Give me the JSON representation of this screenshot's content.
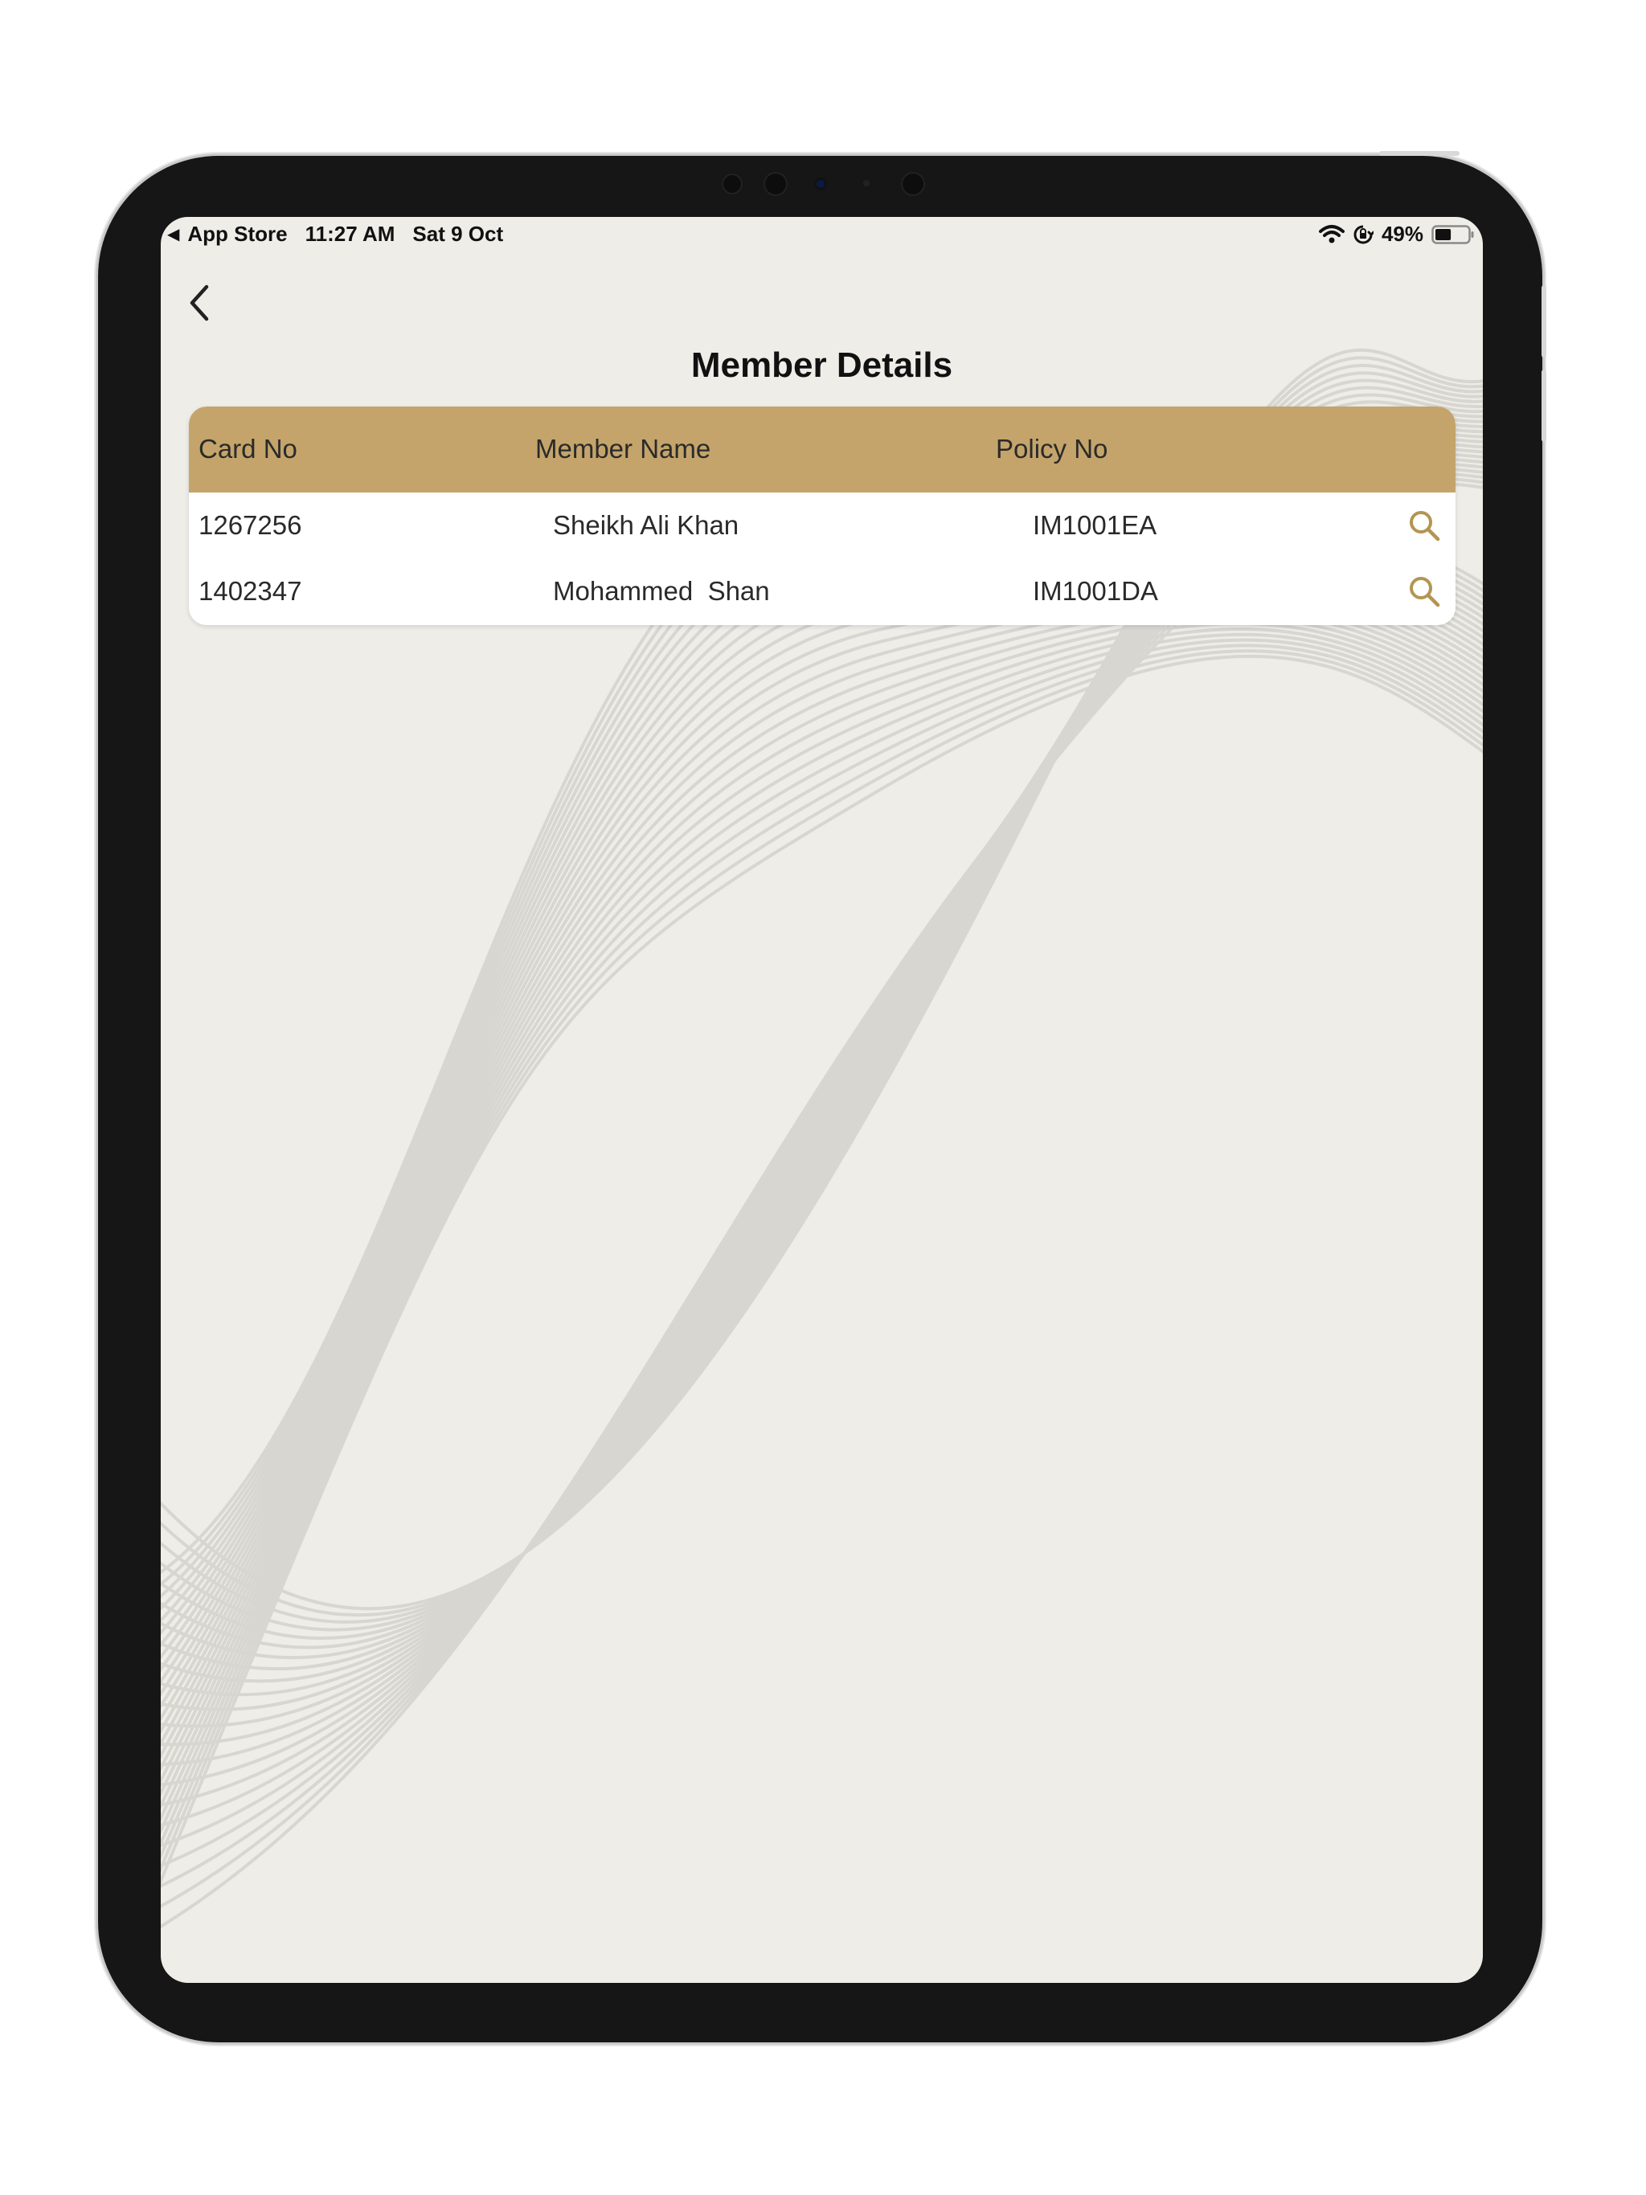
{
  "status_bar": {
    "back_app": "App Store",
    "time": "11:27 AM",
    "date": "Sat 9 Oct",
    "battery": "49%",
    "battery_level": 0.49
  },
  "page": {
    "title": "Member Details"
  },
  "table": {
    "headers": {
      "card_no": "Card No",
      "member_name": "Member Name",
      "policy_no": "Policy No"
    },
    "rows": [
      {
        "card_no": "1267256",
        "member_name": "Sheikh Ali Khan",
        "policy_no": "IM1001EA",
        "action_icon": "search-icon"
      },
      {
        "card_no": "1402347",
        "member_name": "Mohammed  Shan",
        "policy_no": "IM1001DA",
        "action_icon": "search-icon"
      }
    ]
  },
  "colors": {
    "header_bg": "#c4a46a",
    "accent_icon": "#b39552",
    "screen_bg": "#eeede8",
    "device_frame": "#161616"
  }
}
